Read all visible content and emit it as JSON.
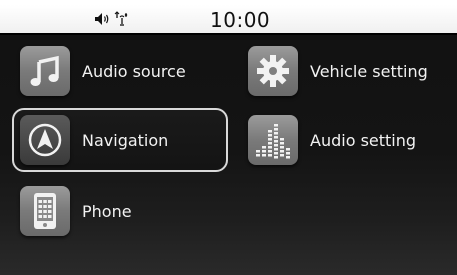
{
  "status_bar": {
    "time": "10:00",
    "icons": [
      "speaker-icon",
      "bluetooth-phone-icon"
    ]
  },
  "menu": {
    "items": [
      {
        "id": "audio-source",
        "label": "Audio source",
        "icon": "music-note-icon"
      },
      {
        "id": "vehicle-setting",
        "label": "Vehicle setting",
        "icon": "gear-icon"
      },
      {
        "id": "navigation",
        "label": "Navigation",
        "icon": "compass-arrow-icon",
        "selected": true
      },
      {
        "id": "audio-setting",
        "label": "Audio setting",
        "icon": "equalizer-icon"
      },
      {
        "id": "phone",
        "label": "Phone",
        "icon": "phone-keypad-icon"
      }
    ]
  },
  "colors": {
    "background": "#141414",
    "tile": "#8a8a8a",
    "label": "#f2f2f2",
    "status_bar": "#ffffff"
  }
}
